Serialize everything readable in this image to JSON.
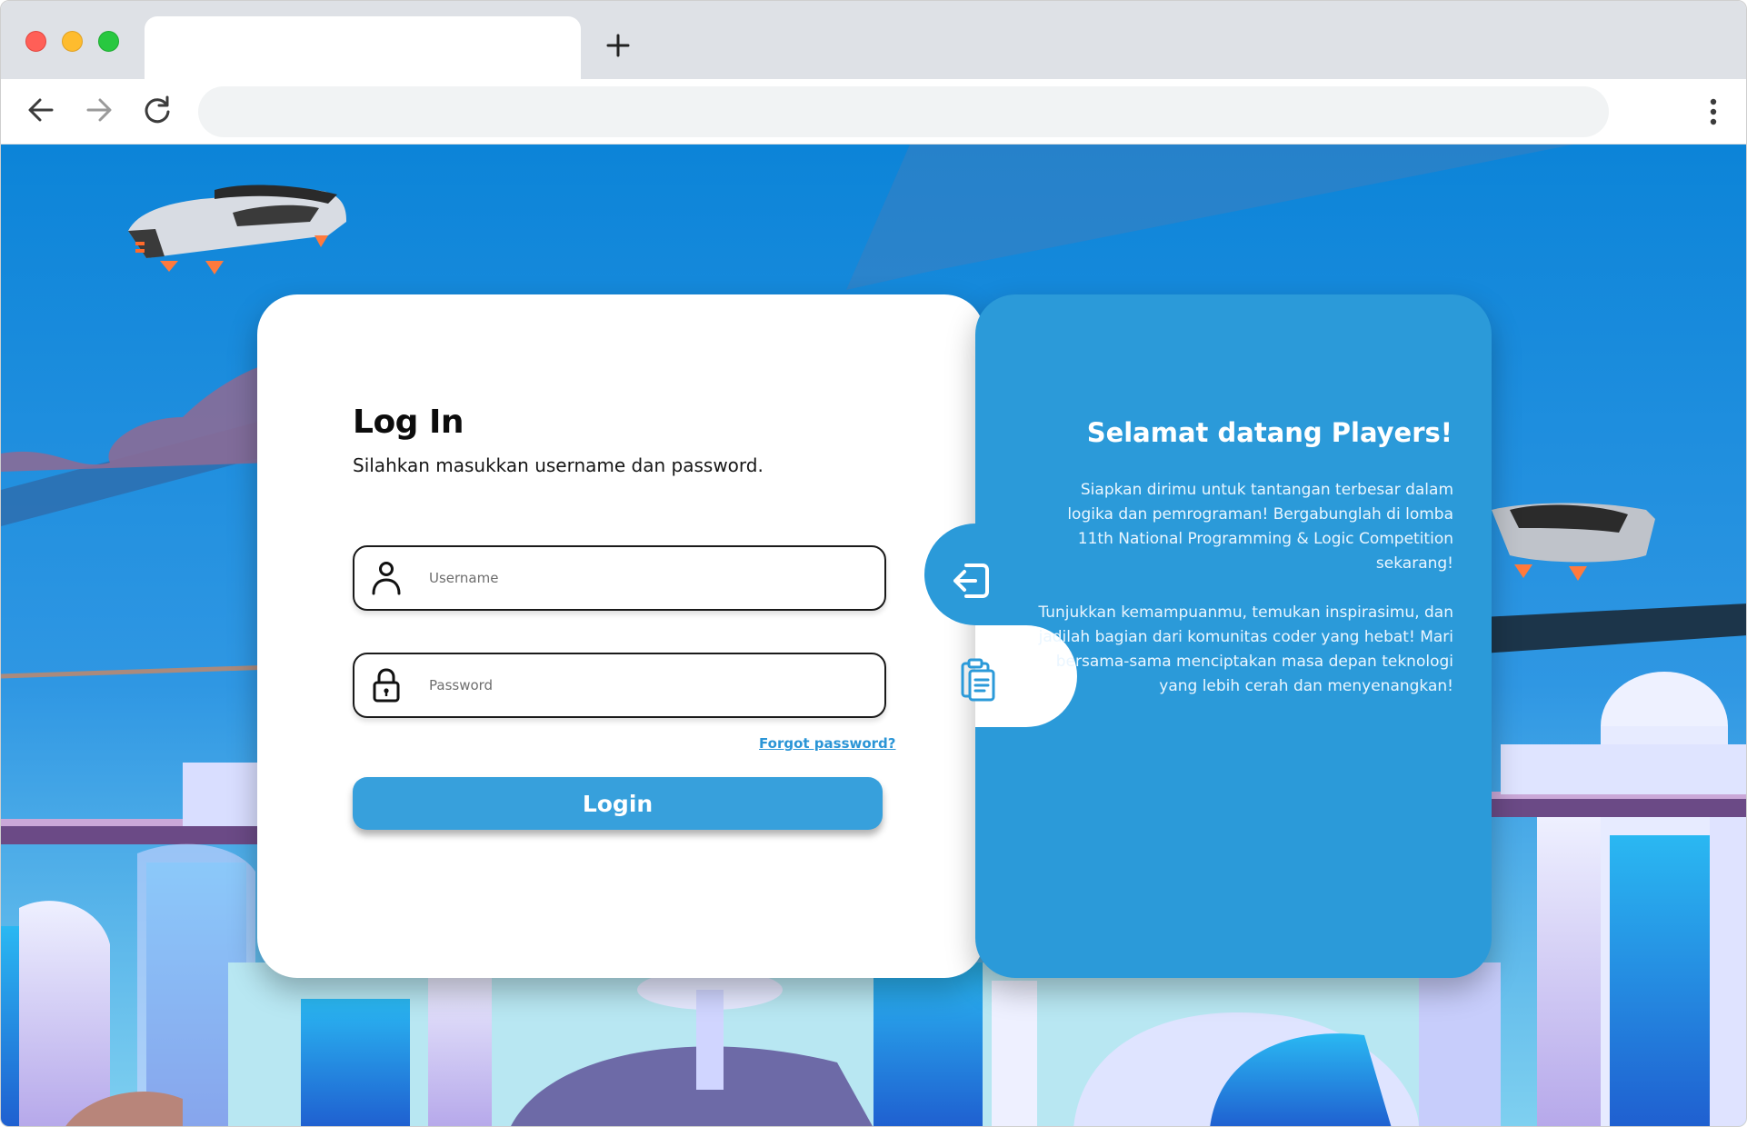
{
  "browser": {
    "tab_title": "",
    "address": ""
  },
  "login": {
    "title": "Log In",
    "subtitle": "Silahkan masukkan username dan password.",
    "username_placeholder": "Username",
    "password_placeholder": "Password",
    "forgot_label": "Forgot password?",
    "button_label": "Login"
  },
  "welcome": {
    "title": "Selamat datang Players!",
    "paragraph1": "Siapkan dirimu untuk tantangan terbesar dalam logika dan pemrograman! Bergabunglah di lomba 11th National Programming & Logic Competition sekarang!",
    "paragraph2": "Tunjukkan kemampuanmu, temukan inspirasimu, dan jadilah bagian dari komunitas coder yang hebat! Mari bersama-sama menciptakan masa depan teknologi yang lebih cerah dan menyenangkan!"
  },
  "icons": {
    "user": "user-icon",
    "lock": "lock-icon",
    "login_tab": "sign-in-icon",
    "register_tab": "clipboard-icon"
  },
  "colors": {
    "accent": "#2b9ad9",
    "button": "#37a0dc",
    "sky": "#1a86d6"
  }
}
